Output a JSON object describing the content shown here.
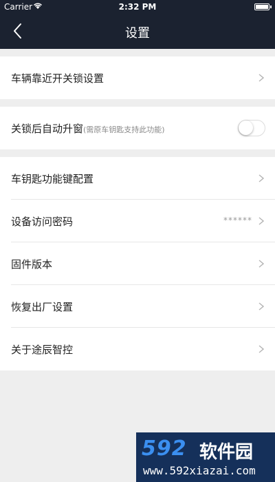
{
  "status_bar": {
    "carrier": "Carrier",
    "time": "2:32 PM"
  },
  "nav": {
    "title": "设置",
    "back_icon": "chevron-left-icon"
  },
  "groups": [
    {
      "rows": [
        {
          "label": "车辆靠近开关锁设置",
          "type": "link"
        }
      ]
    },
    {
      "rows": [
        {
          "label": "关锁后自动升窗",
          "hint": "(需原车钥匙支持此功能)",
          "type": "toggle",
          "on": false
        }
      ]
    },
    {
      "rows": [
        {
          "label": "车钥匙功能键配置",
          "type": "link"
        },
        {
          "label": "设备访问密码",
          "value": "******",
          "type": "link"
        },
        {
          "label": "固件版本",
          "type": "link"
        },
        {
          "label": "恢复出厂设置",
          "type": "link"
        },
        {
          "label": "关于途辰智控",
          "type": "link"
        }
      ]
    }
  ],
  "watermark": {
    "brand_number": "592",
    "brand_text": "软件园",
    "url": "www.592xiazai.com"
  },
  "colors": {
    "nav_background": "#1b2230",
    "page_background": "#eeeeee"
  }
}
